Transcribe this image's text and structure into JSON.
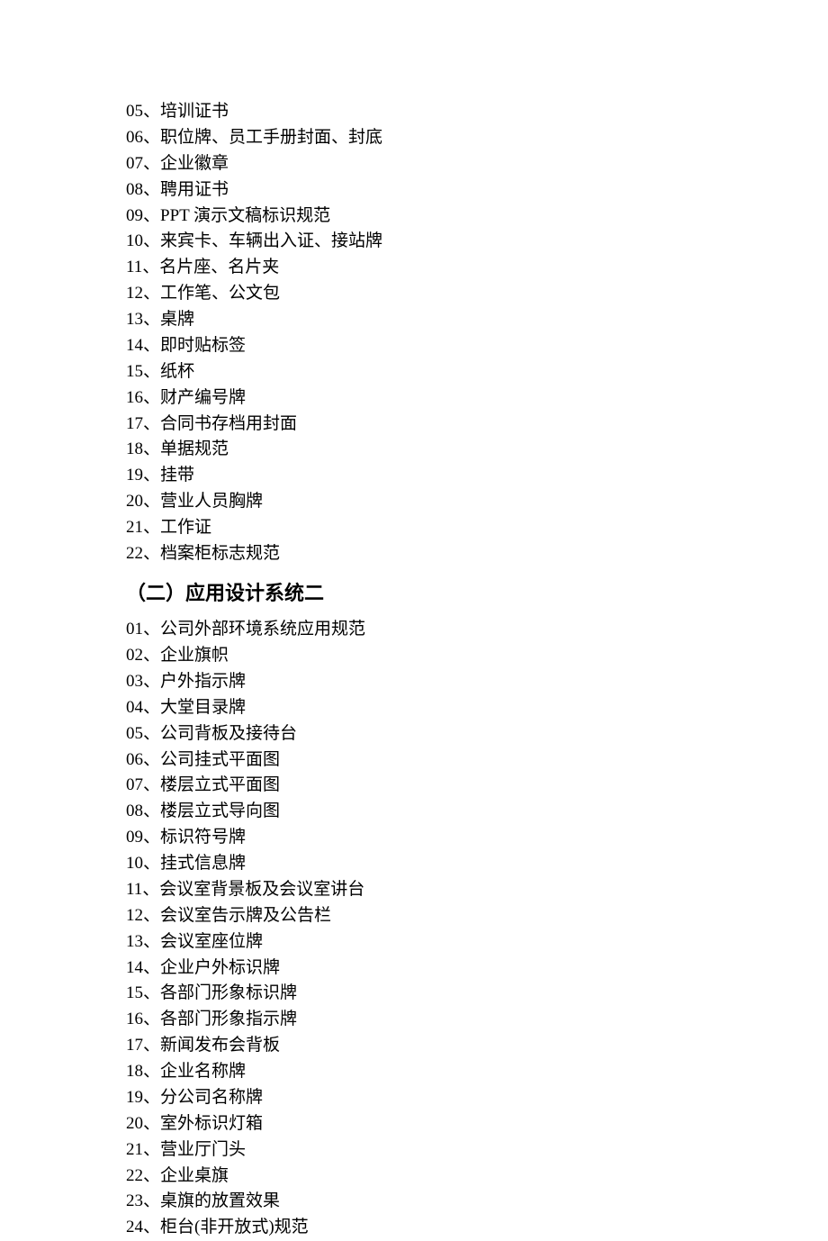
{
  "section1": {
    "items": [
      "05、培训证书",
      "06、职位牌、员工手册封面、封底",
      "07、企业徽章",
      "08、聘用证书",
      "09、PPT 演示文稿标识规范",
      "10、来宾卡、车辆出入证、接站牌",
      "11、名片座、名片夹",
      "12、工作笔、公文包",
      "13、桌牌",
      "14、即时贴标签",
      "15、纸杯",
      "16、财产编号牌",
      "17、合同书存档用封面",
      "18、单据规范",
      "19、挂带",
      "20、营业人员胸牌",
      "21、工作证",
      "22、档案柜标志规范"
    ]
  },
  "section2": {
    "heading": "（二）应用设计系统二",
    "items": [
      "01、公司外部环境系统应用规范",
      "02、企业旗帜",
      "03、户外指示牌",
      "04、大堂目录牌",
      "05、公司背板及接待台",
      "06、公司挂式平面图",
      "07、楼层立式平面图",
      "08、楼层立式导向图",
      "09、标识符号牌",
      "10、挂式信息牌",
      "11、会议室背景板及会议室讲台",
      "12、会议室告示牌及公告栏",
      "13、会议室座位牌",
      "14、企业户外标识牌",
      "15、各部门形象标识牌",
      "16、各部门形象指示牌",
      "17、新闻发布会背板",
      "18、企业名称牌",
      "19、分公司名称牌",
      "20、室外标识灯箱",
      "21、营业厅门头",
      "22、企业桌旗",
      "23、桌旗的放置效果",
      "24、柜台(非开放式)规范"
    ]
  }
}
